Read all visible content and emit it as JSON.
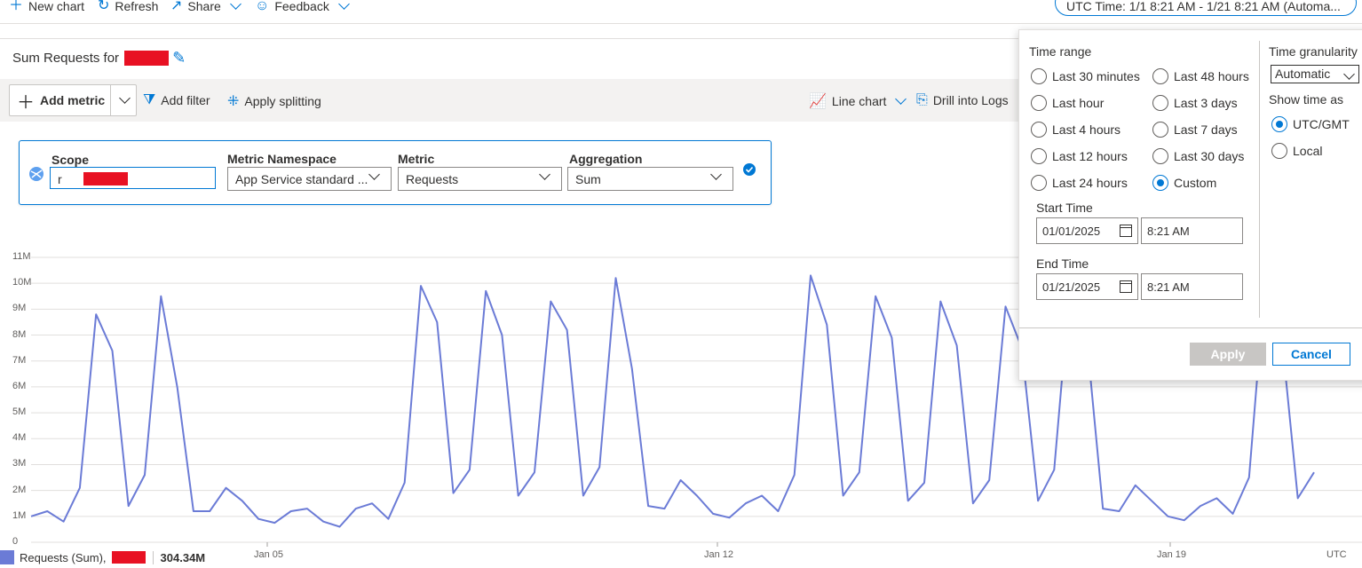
{
  "toolbar": {
    "new_chart": "New chart",
    "refresh": "Refresh",
    "share": "Share",
    "feedback": "Feedback",
    "time_pill": "UTC Time: 1/1 8:21 AM - 1/21 8:21 AM (Automa..."
  },
  "chart_title": "Sum Requests for",
  "commandbar": {
    "add_metric": "Add metric",
    "add_filter": "Add filter",
    "apply_splitting": "Apply splitting",
    "line_chart": "Line chart",
    "drill_logs": "Drill into Logs"
  },
  "metric": {
    "scope_label": "Scope",
    "scope_value": "r",
    "namespace_label": "Metric Namespace",
    "namespace_value": "App Service standard ...",
    "metric_label": "Metric",
    "metric_value": "Requests",
    "aggregation_label": "Aggregation",
    "aggregation_value": "Sum"
  },
  "chart_data": {
    "type": "line",
    "y_ticks": [
      "0",
      "1M",
      "2M",
      "3M",
      "4M",
      "5M",
      "6M",
      "7M",
      "8M",
      "9M",
      "10M",
      "11M"
    ],
    "ylim": [
      0,
      11
    ],
    "x_ticks": [
      "Jan 05",
      "Jan 12",
      "Jan 19",
      "UTC"
    ],
    "series": [
      {
        "name": "Requests (Sum),",
        "color": "#6b7bd6",
        "values": [
          1.0,
          1.2,
          0.8,
          2.1,
          8.8,
          7.4,
          1.4,
          2.6,
          9.5,
          6.0,
          1.2,
          1.2,
          2.1,
          1.6,
          0.9,
          0.75,
          1.2,
          1.3,
          0.8,
          0.6,
          1.3,
          1.5,
          0.9,
          2.3,
          9.9,
          8.5,
          1.9,
          2.8,
          9.7,
          8.0,
          1.8,
          2.7,
          9.3,
          8.2,
          1.8,
          2.9,
          10.2,
          6.7,
          1.4,
          1.3,
          2.4,
          1.8,
          1.1,
          0.95,
          1.5,
          1.8,
          1.2,
          2.6,
          10.3,
          8.4,
          1.8,
          2.7,
          9.5,
          7.9,
          1.6,
          2.3,
          9.3,
          7.6,
          1.5,
          2.4,
          9.1,
          7.5,
          1.6,
          2.8,
          10.1,
          7.9,
          1.3,
          1.2,
          2.2,
          1.6,
          1.0,
          0.85,
          1.4,
          1.7,
          1.1,
          2.5,
          10.2,
          8.0,
          1.7,
          2.7
        ]
      }
    ],
    "legend_total": "304.34M",
    "grid": true
  },
  "timerange": {
    "title": "Time range",
    "options_left": [
      "Last 30 minutes",
      "Last hour",
      "Last 4 hours",
      "Last 12 hours",
      "Last 24 hours"
    ],
    "options_right": [
      "Last 48 hours",
      "Last 3 days",
      "Last 7 days",
      "Last 30 days",
      "Custom"
    ],
    "selected": "Custom",
    "start_label": "Start Time",
    "start_date": "01/01/2025",
    "start_time": "8:21 AM",
    "end_label": "End Time",
    "end_date": "01/21/2025",
    "end_time": "8:21 AM",
    "granularity_label": "Time granularity",
    "granularity_value": "Automatic",
    "show_time_label": "Show time as",
    "tz_utc": "UTC/GMT",
    "tz_local": "Local",
    "apply": "Apply",
    "cancel": "Cancel"
  }
}
